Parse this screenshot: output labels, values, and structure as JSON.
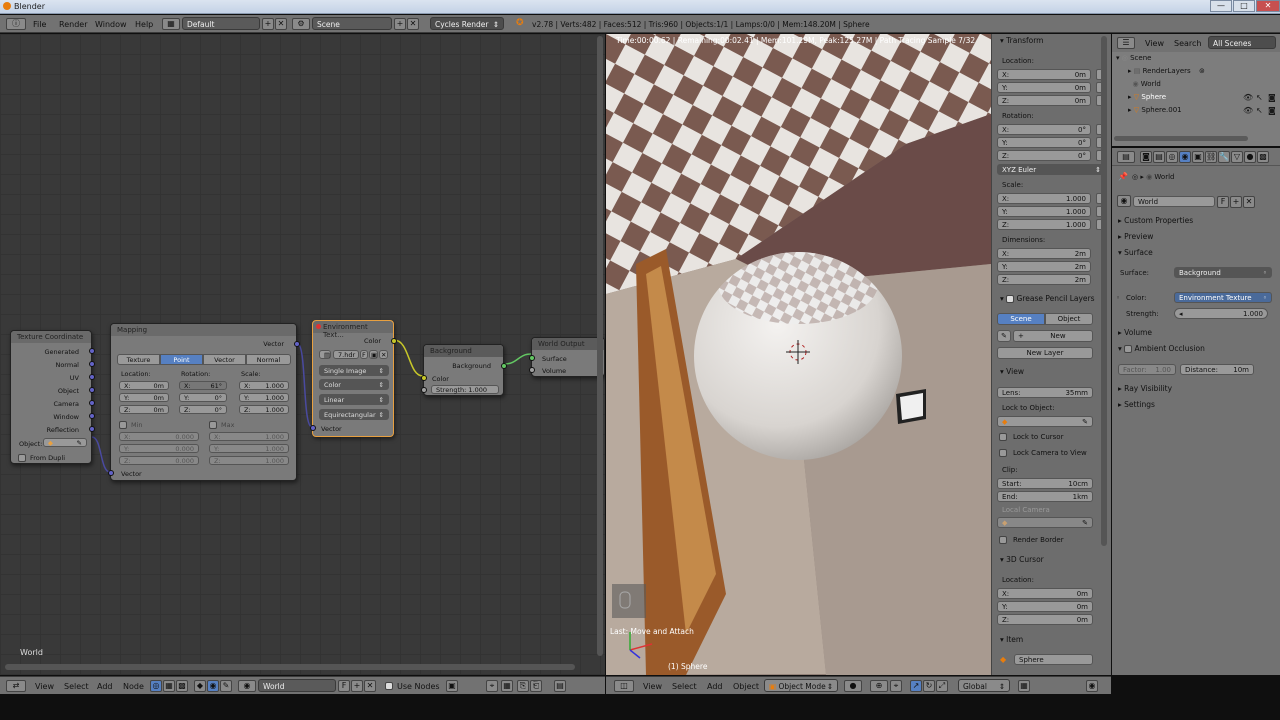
{
  "title_bar": {
    "title": "Blender",
    "min": "—",
    "max": "□",
    "close": "✕"
  },
  "info_header": {
    "menus": [
      "File",
      "Render",
      "Window",
      "Help"
    ],
    "screen_layout": "Default",
    "scene": "Scene",
    "engine": "Cycles Render",
    "stats": "v2.78 | Verts:482 | Faces:512 | Tris:960 | Objects:1/1 | Lamps:0/0 | Mem:148.20M | Sphere"
  },
  "node_editor": {
    "nodes": {
      "texcoord": {
        "title": "Texture Coordinate",
        "outputs": [
          "Generated",
          "Normal",
          "UV",
          "Object",
          "Camera",
          "Window",
          "Reflection"
        ],
        "object_label": "Object:",
        "from_dupli": "From Dupli"
      },
      "mapping": {
        "title": "Mapping",
        "output": "Vector",
        "modes": [
          "Texture",
          "Point",
          "Vector",
          "Normal"
        ],
        "active_mode": "Point",
        "headers": [
          "Location:",
          "Rotation:",
          "Scale:"
        ],
        "location": [
          "X:",
          "0m",
          "Y:",
          "0m",
          "Z:",
          "0m"
        ],
        "rotation": [
          "X:",
          "61°",
          "Y:",
          "0°",
          "Z:",
          "0°"
        ],
        "scale": [
          "X:",
          "1.000",
          "Y:",
          "1.000",
          "Z:",
          "1.000"
        ],
        "min_label": "Min",
        "max_label": "Max",
        "min_vals": [
          "X:",
          "0.000",
          "Y:",
          "0.000",
          "Z:",
          "0.000"
        ],
        "max_vals": [
          "X:",
          "1.000",
          "Y:",
          "1.000",
          "Z:",
          "1.000"
        ],
        "input": "Vector"
      },
      "envtex": {
        "title": "Environment Text...",
        "output": "Color",
        "image": "7.hdr",
        "image_f": "F",
        "dropdowns": [
          "Single Image",
          "Color",
          "Linear",
          "Equirectangular"
        ],
        "input": "Vector"
      },
      "background": {
        "title": "Background",
        "output": "Background",
        "input": "Color",
        "strength": "Strength:",
        "strength_value": "1.000"
      },
      "world_output": {
        "title": "World Output",
        "inputs": [
          "Surface",
          "Volume"
        ]
      }
    },
    "label": "World",
    "footer": {
      "menus": [
        "View",
        "Select",
        "Add",
        "Node"
      ],
      "world": "World",
      "world_f": "F",
      "use_nodes": "Use Nodes"
    }
  },
  "viewport": {
    "status": "Time:00:00.62 | Remaining:00:02.41 | Mem:101.29M, Peak:125.27M | Path Tracing Sample 7/32",
    "last_op": "Last: Move and Attach",
    "object_label": "(1) Sphere",
    "footer": {
      "menus": [
        "View",
        "Select",
        "Add",
        "Object"
      ],
      "mode": "Object Mode",
      "orientation": "Global"
    }
  },
  "npanel": {
    "transform": "Transform",
    "location": "Location:",
    "loc": [
      [
        "X:",
        "0m"
      ],
      [
        "Y:",
        "0m"
      ],
      [
        "Z:",
        "0m"
      ]
    ],
    "rotation": "Rotation:",
    "rot": [
      [
        "X:",
        "0°"
      ],
      [
        "Y:",
        "0°"
      ],
      [
        "Z:",
        "0°"
      ]
    ],
    "rot_mode": "XYZ Euler",
    "scale": "Scale:",
    "scl": [
      [
        "X:",
        "1.000"
      ],
      [
        "Y:",
        "1.000"
      ],
      [
        "Z:",
        "1.000"
      ]
    ],
    "dimensions": "Dimensions:",
    "dim": [
      [
        "X:",
        "2m"
      ],
      [
        "Y:",
        "2m"
      ],
      [
        "Z:",
        "2m"
      ]
    ],
    "gp_layers": "Grease Pencil Layers",
    "gp_scene": "Scene",
    "gp_object": "Object",
    "gp_new": "New",
    "gp_new_layer": "New Layer",
    "view": "View",
    "lens": "Lens:",
    "lens_val": "35mm",
    "lock_to_object": "Lock to Object:",
    "lock_to_cursor": "Lock to Cursor",
    "lock_cam": "Lock Camera to View",
    "clip": "Clip:",
    "clip_start": "Start:",
    "clip_start_val": "10cm",
    "clip_end": "End:",
    "clip_end_val": "1km",
    "local_camera": "Local Camera",
    "render_border": "Render Border",
    "cursor": "3D Cursor",
    "cursor_location": "Location:",
    "cur": [
      [
        "X:",
        "0m"
      ],
      [
        "Y:",
        "0m"
      ],
      [
        "Z:",
        "0m"
      ]
    ],
    "item": "Item",
    "item_name": "Sphere"
  },
  "outliner": {
    "menus": [
      "View",
      "Search"
    ],
    "filter": "All Scenes",
    "tree": [
      "Scene",
      "RenderLayers",
      "World",
      "Sphere",
      "Sphere.001"
    ]
  },
  "properties": {
    "breadcrumb": "World",
    "world_name": "World",
    "world_f": "F",
    "panels": [
      "Custom Properties",
      "Preview"
    ],
    "surface": "Surface",
    "surface_label": "Surface:",
    "surface_val": "Background",
    "color_label": "Color:",
    "color_val": "Environment Texture",
    "strength_label": "Strength:",
    "strength_val": "1.000",
    "volume": "Volume",
    "ao": "Ambient Occlusion",
    "factor": "Factor:",
    "factor_val": "1.00",
    "distance": "Distance:",
    "distance_val": "10m",
    "ray_vis": "Ray Visibility",
    "settings": "Settings"
  }
}
